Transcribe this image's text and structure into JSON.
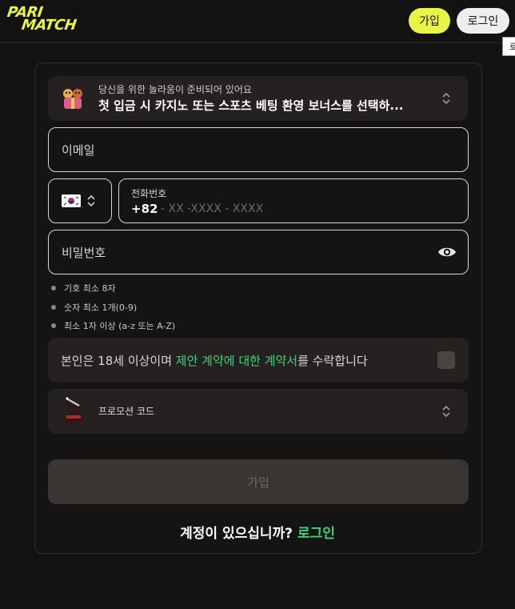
{
  "header": {
    "logo_line1": "PARI",
    "logo_line2": "MATCH",
    "signup_label": "가입",
    "login_label": "로그인",
    "tooltip_text": "로"
  },
  "bonus": {
    "subtitle": "당신을 위한 놀라움이 준비되어 있어요",
    "title": "첫 입금 시 카지노 또는 스포츠 베팅 환영 보너스를 선택하..."
  },
  "form": {
    "email_placeholder": "이메일",
    "phone_label": "전화번호",
    "phone_code": "+82",
    "phone_mask": "- XX -XXXX - XXXX",
    "password_placeholder": "비밀번호",
    "country_icon": "korea-flag-icon"
  },
  "password_rules": [
    "기호 최소 8자",
    "숫자 최소 1개(0-9)",
    "최소 1자 이상 (a-z 또는 A-Z)"
  ],
  "agreement": {
    "prefix": "본인은 18세 이상이며 ",
    "link": "제안 계약에 대한 계약서",
    "suffix": "를 수락합니다"
  },
  "promo": {
    "label": "프로모션 코드"
  },
  "submit_label": "가입",
  "footer": {
    "question": "계정이 있으십니까? ",
    "login_link": "로그인"
  },
  "colors": {
    "accent_yellow": "#e8f545",
    "link_green": "#3fd17c",
    "background": "#121212"
  }
}
